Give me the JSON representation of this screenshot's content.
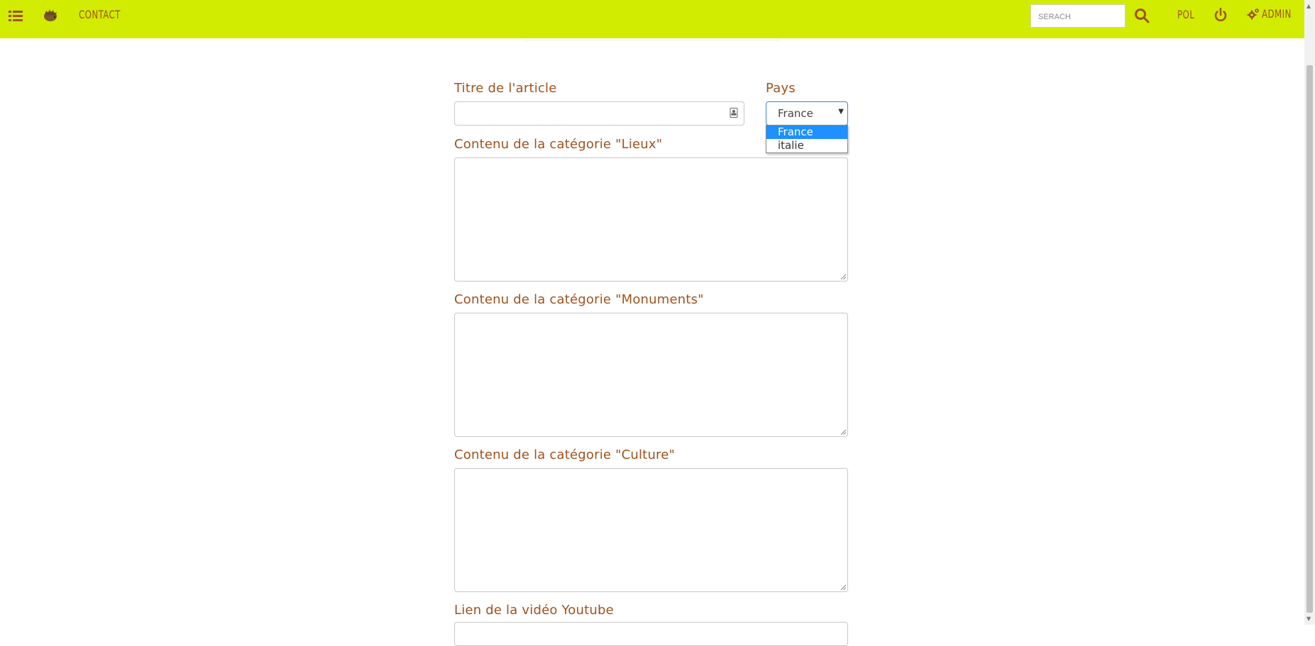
{
  "navbar": {
    "bg_color": "#d1ec00",
    "text_color": "#a0521e",
    "menu_icon": "list-icon",
    "logo_icon": "hedgehog-logo-icon",
    "contact_label": "CONTACT",
    "search_placeholder": "SERACH",
    "search_icon": "search-icon",
    "lang_label": "POL",
    "power_icon": "power-icon",
    "admin_icon": "cogs-icon",
    "admin_label": "ADMIN"
  },
  "form": {
    "title_label": "Titre de l'article",
    "title_value": "",
    "country_label": "Pays",
    "country_selected": "France",
    "country_options": [
      "France",
      "italie"
    ],
    "lieux_label": "Contenu de la catégorie \"Lieux\"",
    "monuments_label": "Contenu de la catégorie \"Monuments\"",
    "culture_label": "Contenu de la catégorie \"Culture\"",
    "youtube_label": "Lien de la vidéo Youtube",
    "accent_color": "#a0521e",
    "focus_color": "#3b86d8"
  }
}
